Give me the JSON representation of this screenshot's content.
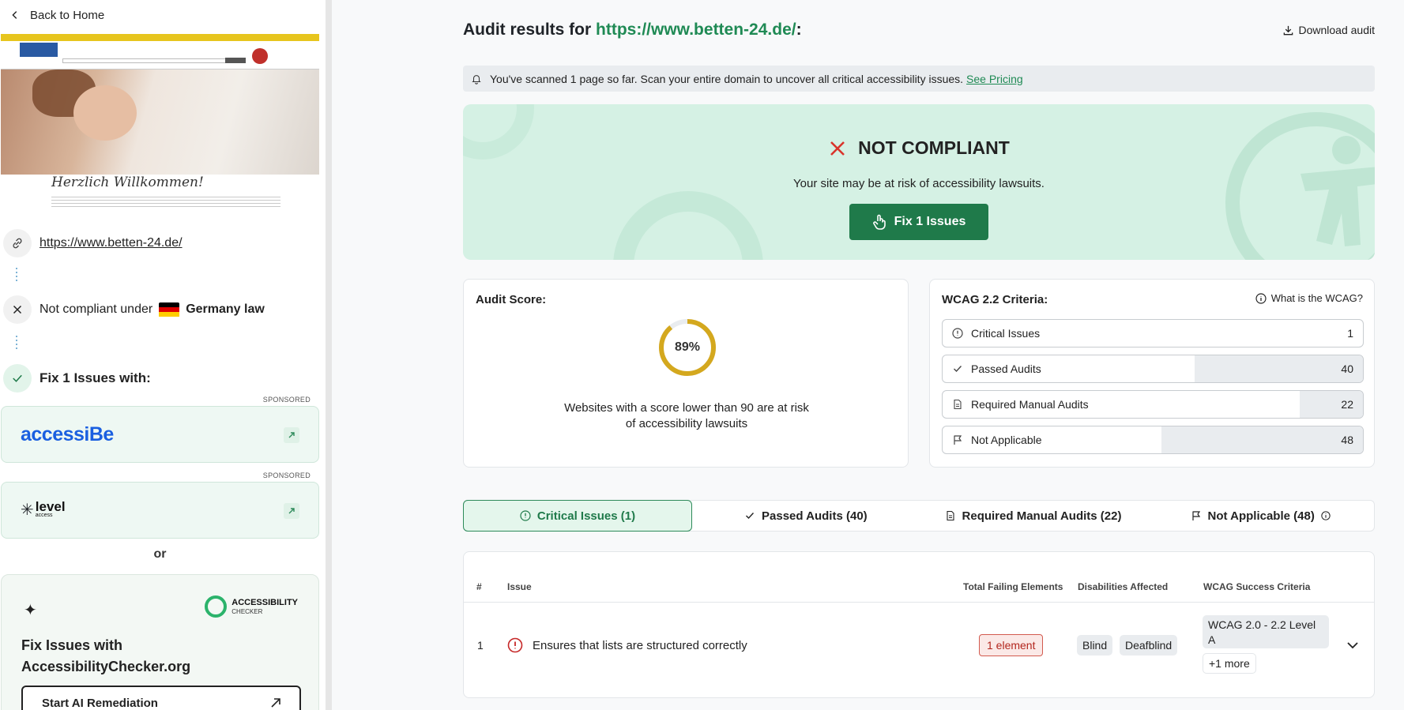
{
  "sidebar": {
    "back_label": "Back to Home",
    "preview_welcome": "Herzlich Willkommen!",
    "site_url": "https://www.betten-24.de/",
    "compliance_text": "Not compliant under",
    "country": "Germany law",
    "fix_heading": "Fix 1 Issues with:",
    "sponsored_label": "SPONSORED",
    "sponsor1": "accessiBe",
    "sponsor2": "level",
    "sponsor2_sub": "access",
    "or_label": "or",
    "ac_logo_1": "ACCESSIBILITY",
    "ac_logo_2": "CHECKER",
    "ac_title": "Fix Issues with AccessibilityChecker.org",
    "ac_button": "Start AI Remediation"
  },
  "header": {
    "title_prefix": "Audit results for ",
    "title_url": "https://www.betten-24.de/",
    "title_suffix": ":",
    "download_label": "Download audit"
  },
  "notice": {
    "text": "You've scanned 1 page so far. Scan your entire domain to uncover all critical accessibility issues.",
    "link": "See Pricing"
  },
  "banner": {
    "status": "NOT COMPLIANT",
    "subtitle": "Your site may be at risk of accessibility lawsuits.",
    "button": "Fix 1 Issues"
  },
  "score": {
    "heading": "Audit Score:",
    "value_label": "89%",
    "value": 89,
    "note_line1": "Websites with a score lower than 90 are at risk",
    "note_line2": "of accessibility lawsuits",
    "accent": "#d4a81e"
  },
  "wcag": {
    "heading": "WCAG 2.2 Criteria:",
    "help": "What is the WCAG?",
    "rows": [
      {
        "label": "Critical Issues",
        "count": "1",
        "share": 0
      },
      {
        "label": "Passed Audits",
        "count": "40",
        "share": 0.4
      },
      {
        "label": "Required Manual Audits",
        "count": "22",
        "share": 0.15
      },
      {
        "label": "Not Applicable",
        "count": "48",
        "share": 0.48
      }
    ]
  },
  "tabs": [
    {
      "label": "Critical Issues (1)"
    },
    {
      "label": "Passed Audits (40)"
    },
    {
      "label": "Required Manual Audits (22)"
    },
    {
      "label": "Not Applicable (48)"
    }
  ],
  "table": {
    "headers": {
      "num": "#",
      "issue": "Issue",
      "failing": "Total Failing Elements",
      "disabilities": "Disabilities Affected",
      "criteria": "WCAG Success Criteria"
    },
    "rows": [
      {
        "num": "1",
        "issue": "Ensures that lists are structured correctly",
        "failing": "1 element",
        "disabilities": [
          "Blind",
          "Deafblind"
        ],
        "criteria": "WCAG 2.0 - 2.2 Level A",
        "more": "+1 more"
      }
    ]
  },
  "colors": {
    "brand_green": "#1f7a4a",
    "url_green": "#1f8a54",
    "danger": "#d9342b"
  }
}
